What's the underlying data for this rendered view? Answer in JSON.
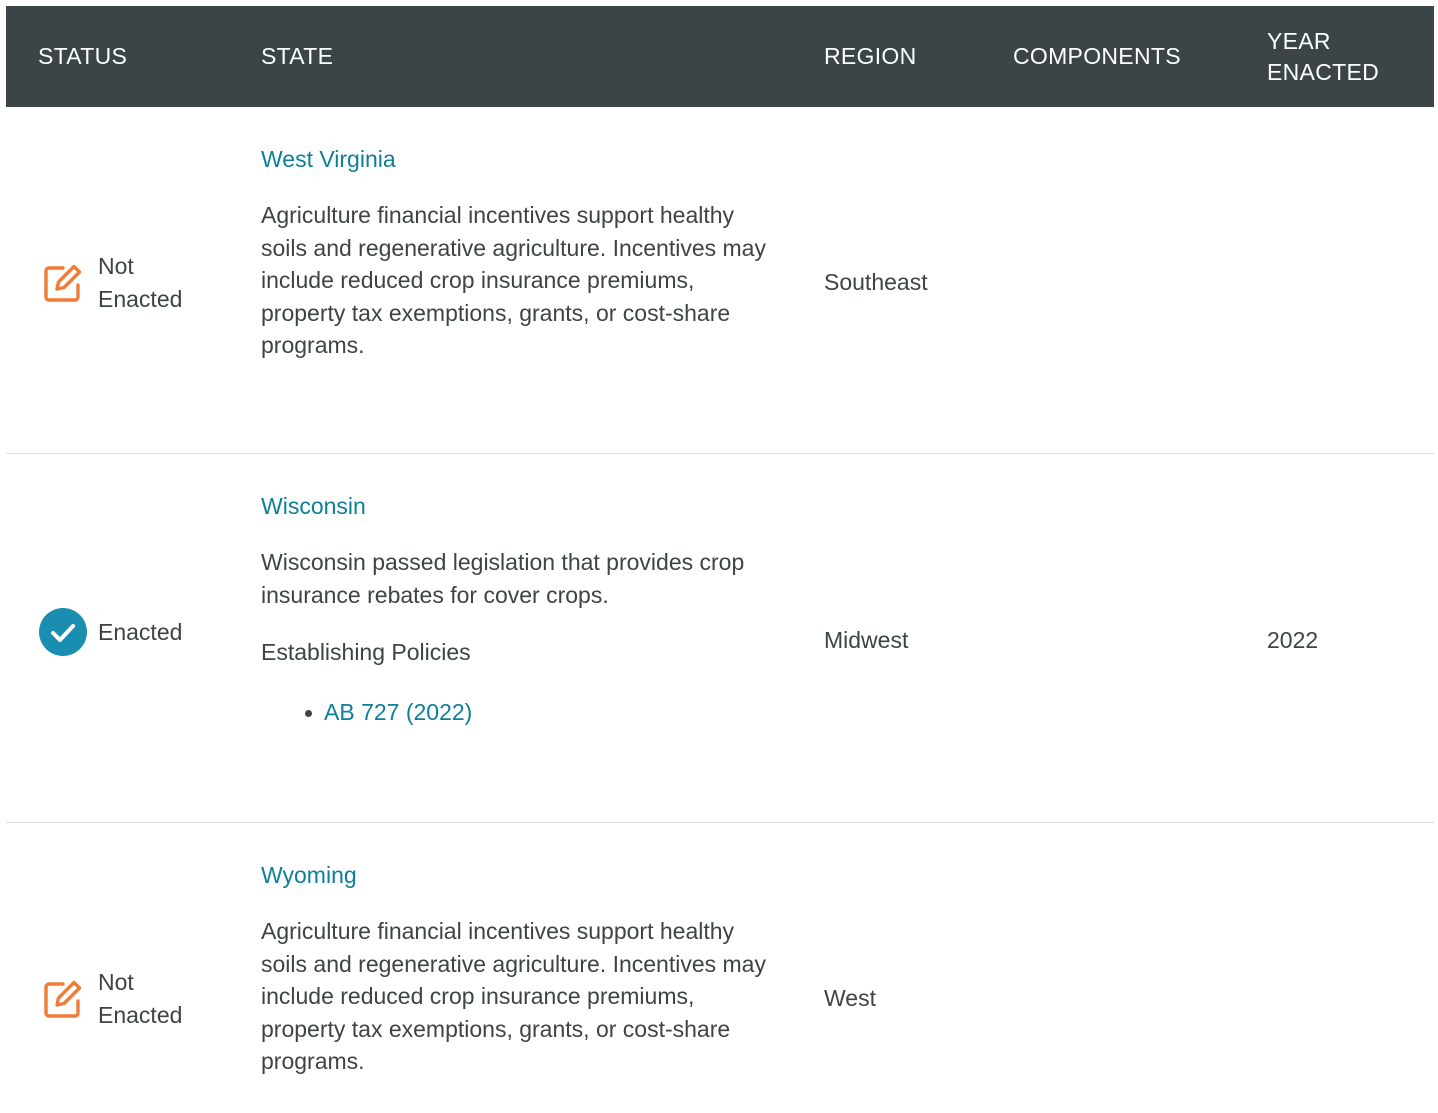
{
  "colors": {
    "header_bg": "#3b4548",
    "link": "#0d7f99",
    "not_enacted_icon": "#f07c37",
    "enacted_icon": "#1a8eb1",
    "body_text": "#3d4543",
    "divider": "#dcdfe0"
  },
  "table": {
    "headers": {
      "status": "STATUS",
      "state": "STATE",
      "region": "REGION",
      "components": "COMPONENTS",
      "year_line1": "YEAR",
      "year_line2": "ENACTED"
    },
    "rows": [
      {
        "status": {
          "icon": "edit-pencil-icon",
          "line1": "Not",
          "line2": "Enacted"
        },
        "state": "West Virginia",
        "description": "Agriculture financial incentives support healthy soils and regenerative agriculture. Incentives may include reduced crop insurance premiums, property tax exemptions, grants, or cost-share programs.",
        "region": "Southeast",
        "components": "",
        "year": ""
      },
      {
        "status": {
          "icon": "checkmark-circle-icon",
          "line1": "Enacted"
        },
        "state": "Wisconsin",
        "description": "Wisconsin passed legislation that provides crop insurance rebates for cover crops.",
        "policies_heading": "Establishing Policies",
        "policies": [
          "AB 727 (2022)"
        ],
        "region": "Midwest",
        "components": "",
        "year": "2022"
      },
      {
        "status": {
          "icon": "edit-pencil-icon",
          "line1": "Not",
          "line2": "Enacted"
        },
        "state": "Wyoming",
        "description": "Agriculture financial incentives support healthy soils and regenerative agriculture. Incentives may include reduced crop insurance premiums, property tax exemptions, grants, or cost-share programs.",
        "region": "West",
        "components": "",
        "year": ""
      }
    ]
  }
}
